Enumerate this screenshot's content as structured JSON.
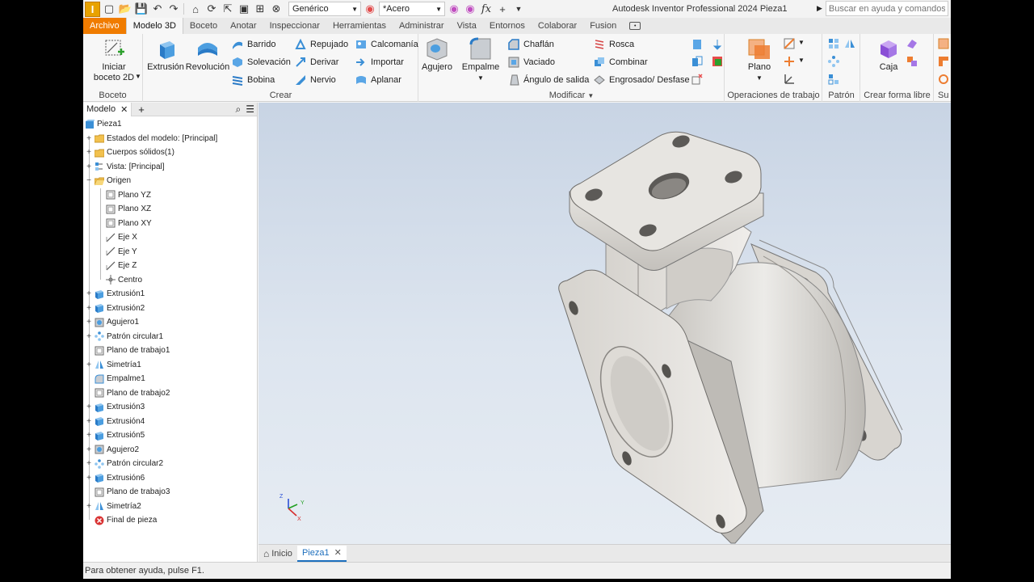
{
  "app": {
    "title": "Autodesk Inventor Professional 2024   Pieza1",
    "logo_letter": "I"
  },
  "quick_access": {
    "appearance_combo": "Genérico",
    "material_combo": "*Acero",
    "fx_label": "fx"
  },
  "search": {
    "placeholder": "Buscar en ayuda y comandos..."
  },
  "tabs": [
    {
      "label": "Archivo"
    },
    {
      "label": "Modelo 3D"
    },
    {
      "label": "Boceto"
    },
    {
      "label": "Anotar"
    },
    {
      "label": "Inspeccionar"
    },
    {
      "label": "Herramientas"
    },
    {
      "label": "Administrar"
    },
    {
      "label": "Vista"
    },
    {
      "label": "Entornos"
    },
    {
      "label": "Colaborar"
    },
    {
      "label": "Fusion"
    }
  ],
  "ribbon": {
    "boceto": {
      "label": "Boceto",
      "start_sketch": "Iniciar\nboceto 2D"
    },
    "crear": {
      "label": "Crear",
      "extrusion": "Extrusión",
      "revolucion": "Revolución",
      "barrido": "Barrido",
      "solevacion": "Solevación",
      "bobina": "Bobina",
      "repujado": "Repujado",
      "derivar": "Derivar",
      "nervio": "Nervio",
      "calcomania": "Calcomanía",
      "importar": "Importar",
      "aplanar": "Aplanar"
    },
    "modificar": {
      "label": "Modificar",
      "agujero": "Agujero",
      "empalme": "Empalme",
      "chaflan": "Chaflán",
      "vaciado": "Vaciado",
      "angulo": "Ángulo de salida",
      "rosca": "Rosca",
      "combinar": "Combinar",
      "engrosado": "Engrosado/ Desfase"
    },
    "operaciones": {
      "label": "Operaciones de trabajo",
      "plano": "Plano"
    },
    "patron": {
      "label": "Patrón"
    },
    "forma_libre": {
      "label": "Crear forma libre",
      "caja": "Caja"
    },
    "cut_panel": {
      "label": "Su"
    }
  },
  "browser": {
    "tab_label": "Modelo",
    "items": [
      {
        "label": "Pieza1",
        "icon": "part-icon",
        "level": 0,
        "exp": ""
      },
      {
        "label": "Estados del modelo: [Principal]",
        "icon": "folder-icon",
        "level": 1,
        "exp": "+"
      },
      {
        "label": "Cuerpos sólidos(1)",
        "icon": "folder-icon",
        "level": 1,
        "exp": "+"
      },
      {
        "label": "Vista: [Principal]",
        "icon": "view-icon",
        "level": 1,
        "exp": "+"
      },
      {
        "label": "Origen",
        "icon": "folder-open-icon",
        "level": 1,
        "exp": "−"
      },
      {
        "label": "Plano YZ",
        "icon": "plane-icon",
        "level": 2,
        "exp": ""
      },
      {
        "label": "Plano XZ",
        "icon": "plane-icon",
        "level": 2,
        "exp": ""
      },
      {
        "label": "Plano XY",
        "icon": "plane-icon",
        "level": 2,
        "exp": ""
      },
      {
        "label": "Eje X",
        "icon": "axis-icon",
        "level": 2,
        "exp": ""
      },
      {
        "label": "Eje Y",
        "icon": "axis-icon",
        "level": 2,
        "exp": ""
      },
      {
        "label": "Eje Z",
        "icon": "axis-icon",
        "level": 2,
        "exp": ""
      },
      {
        "label": "Centro",
        "icon": "point-icon",
        "level": 2,
        "exp": ""
      },
      {
        "label": "Extrusión1",
        "icon": "extrude-icon",
        "level": 1,
        "exp": "+"
      },
      {
        "label": "Extrusión2",
        "icon": "extrude-icon",
        "level": 1,
        "exp": "+"
      },
      {
        "label": "Agujero1",
        "icon": "hole-icon",
        "level": 1,
        "exp": "+"
      },
      {
        "label": "Patrón circular1",
        "icon": "pattern-icon",
        "level": 1,
        "exp": "+"
      },
      {
        "label": "Plano de trabajo1",
        "icon": "plane-icon",
        "level": 1,
        "exp": ""
      },
      {
        "label": "Simetría1",
        "icon": "mirror-icon",
        "level": 1,
        "exp": "+"
      },
      {
        "label": "Empalme1",
        "icon": "fillet-icon",
        "level": 1,
        "exp": ""
      },
      {
        "label": "Plano de trabajo2",
        "icon": "plane-icon",
        "level": 1,
        "exp": ""
      },
      {
        "label": "Extrusión3",
        "icon": "extrude-icon",
        "level": 1,
        "exp": "+"
      },
      {
        "label": "Extrusión4",
        "icon": "extrude-icon",
        "level": 1,
        "exp": "+"
      },
      {
        "label": "Extrusión5",
        "icon": "extrude-icon",
        "level": 1,
        "exp": "+"
      },
      {
        "label": "Agujero2",
        "icon": "hole-icon",
        "level": 1,
        "exp": "+"
      },
      {
        "label": "Patrón circular2",
        "icon": "pattern-icon",
        "level": 1,
        "exp": "+"
      },
      {
        "label": "Extrusión6",
        "icon": "extrude-icon",
        "level": 1,
        "exp": "+"
      },
      {
        "label": "Plano de trabajo3",
        "icon": "plane-icon",
        "level": 1,
        "exp": ""
      },
      {
        "label": "Simetría2",
        "icon": "mirror-icon",
        "level": 1,
        "exp": "+"
      },
      {
        "label": "Final de pieza",
        "icon": "end-icon",
        "level": 1,
        "exp": ""
      }
    ]
  },
  "viewcube": {
    "x": "X",
    "y": "Y",
    "z": "Z"
  },
  "doc_tabs": {
    "home": "Inicio",
    "doc": "Pieza1"
  },
  "status": {
    "text": "Para obtener ayuda, pulse F1."
  },
  "colors": {
    "file_tab": "#f07c00",
    "accent": "#1d6fbd",
    "part": "#e8e6e2"
  }
}
